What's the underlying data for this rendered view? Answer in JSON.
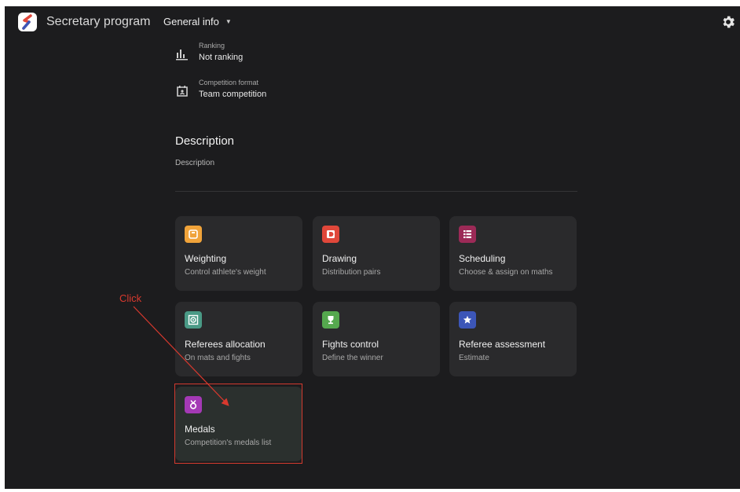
{
  "header": {
    "app_title": "Secretary program",
    "nav_dropdown": "General info"
  },
  "info": [
    {
      "label": "Ranking",
      "value": "Not ranking",
      "icon": "bar-chart-icon"
    },
    {
      "label": "Competition format",
      "value": "Team competition",
      "icon": "calendar-person-icon"
    }
  ],
  "description": {
    "title": "Description",
    "text": "Description"
  },
  "cards": [
    {
      "title": "Weighting",
      "subtitle": "Control athlete's weight",
      "icon": "scale-icon",
      "color": "#f0a33a"
    },
    {
      "title": "Drawing",
      "subtitle": "Distribution pairs",
      "icon": "d-letter-icon",
      "color": "#e0473a"
    },
    {
      "title": "Scheduling",
      "subtitle": "Choose & assign on maths",
      "icon": "schedule-list-icon",
      "color": "#9c2a57"
    },
    {
      "title": "Referees allocation",
      "subtitle": "On mats and fights",
      "icon": "target-square-icon",
      "color": "#4a9a86"
    },
    {
      "title": "Fights control",
      "subtitle": "Define the winner",
      "icon": "trophy-icon",
      "color": "#55a84e"
    },
    {
      "title": "Referee assessment",
      "subtitle": "Estimate",
      "icon": "star-badge-icon",
      "color": "#3c56b8"
    },
    {
      "title": "Medals",
      "subtitle": "Competition's medals list",
      "icon": "medal-icon",
      "color": "#a439b5"
    }
  ],
  "annotation": {
    "label": "Click",
    "color": "#d9392e"
  }
}
